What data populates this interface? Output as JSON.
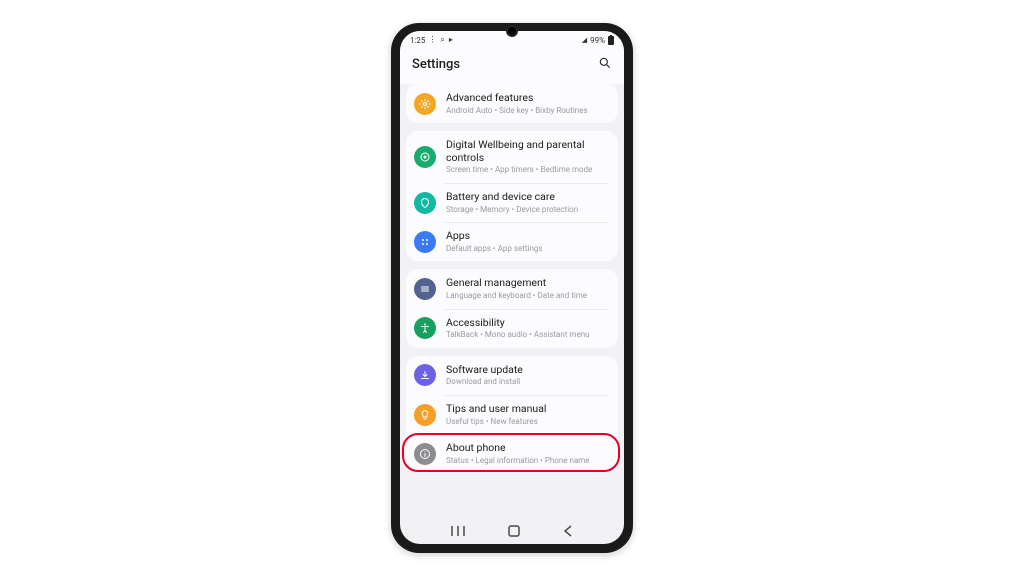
{
  "status": {
    "time": "1:25",
    "battery": "99%"
  },
  "header": {
    "title": "Settings"
  },
  "groups": [
    {
      "rows": [
        {
          "title": "Advanced features",
          "sub": "Android Auto  •  Side key  •  Bixby Routines",
          "icon_bg": "#f5a623",
          "icon": "gear-icon"
        }
      ]
    },
    {
      "rows": [
        {
          "title": "Digital Wellbeing and parental controls",
          "sub": "Screen time  •  App timers  •  Bedtime mode",
          "icon_bg": "#1aab6e",
          "icon": "wellbeing-icon"
        },
        {
          "title": "Battery and device care",
          "sub": "Storage  •  Memory  •  Device protection",
          "icon_bg": "#13b9a3",
          "icon": "care-icon"
        },
        {
          "title": "Apps",
          "sub": "Default apps  •  App settings",
          "icon_bg": "#3a7af5",
          "icon": "apps-icon"
        }
      ]
    },
    {
      "rows": [
        {
          "title": "General management",
          "sub": "Language and keyboard  •  Date and time",
          "icon_bg": "#53638f",
          "icon": "general-icon"
        },
        {
          "title": "Accessibility",
          "sub": "TalkBack  •  Mono audio  •  Assistant menu",
          "icon_bg": "#18a05e",
          "icon": "accessibility-icon"
        }
      ]
    },
    {
      "rows": [
        {
          "title": "Software update",
          "sub": "Download and install",
          "icon_bg": "#6c62e8",
          "icon": "update-icon"
        },
        {
          "title": "Tips and user manual",
          "sub": "Useful tips  •  New features",
          "icon_bg": "#f59f26",
          "icon": "tips-icon"
        },
        {
          "title": "About phone",
          "sub": "Status  •  Legal information  •  Phone name",
          "icon_bg": "#8c8c92",
          "icon": "info-icon",
          "highlighted": true
        }
      ]
    }
  ],
  "nav": {
    "recent": "|||",
    "home": "◯",
    "back": "‹"
  }
}
